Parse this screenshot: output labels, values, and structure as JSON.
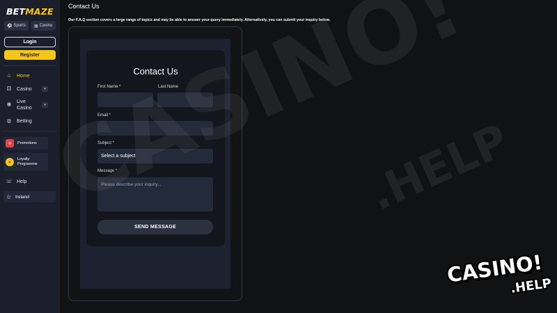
{
  "sidebar": {
    "logo_left": "BET",
    "logo_right": "MAZE",
    "pills": [
      {
        "label": "Sports",
        "icon": "soccer-ball-icon"
      },
      {
        "label": "Casino",
        "icon": "cards-icon"
      }
    ],
    "login_label": "Login",
    "register_label": "Register",
    "nav": [
      {
        "label": "Home",
        "icon": "home-icon",
        "active": true
      },
      {
        "label": "Casino",
        "icon": "dice-icon"
      },
      {
        "label": "Live",
        "label2": "Casino",
        "icon": "live-casino-icon"
      },
      {
        "label": "Betting",
        "icon": "football-icon"
      }
    ],
    "cards": [
      {
        "label": "Promotions",
        "icon": "gift-icon"
      },
      {
        "label": "Loyalty",
        "label2": "Programme",
        "icon": "loyalty-coin-icon"
      }
    ],
    "help_label": "Help",
    "region_label": "Ireland"
  },
  "main": {
    "page_title": "Contact Us",
    "intro": "Our F.A.Q section covers a large range of topics and may be able to answer your query immediately. Alternatively, you can submit your inquiry below."
  },
  "form": {
    "title": "Contact Us",
    "first_name_label": "First Name *",
    "last_name_label": "Last Name",
    "email_label": "Email *",
    "subject_label": "Subject *",
    "subject_value": "Select a subject",
    "message_label": "Message *",
    "message_placeholder": "Please describe your inquiry...",
    "send_label": "SEND MESSAGE"
  },
  "watermark": {
    "big_text": "CASINO!",
    "big_help": ".HELP",
    "logo_line1": "CASINO!",
    "logo_line2": ".HELP"
  },
  "colors": {
    "accent": "#f5c518",
    "sidebar_bg": "#1b1f2b",
    "page_bg": "#111214",
    "field_bg": "#232a3a"
  }
}
